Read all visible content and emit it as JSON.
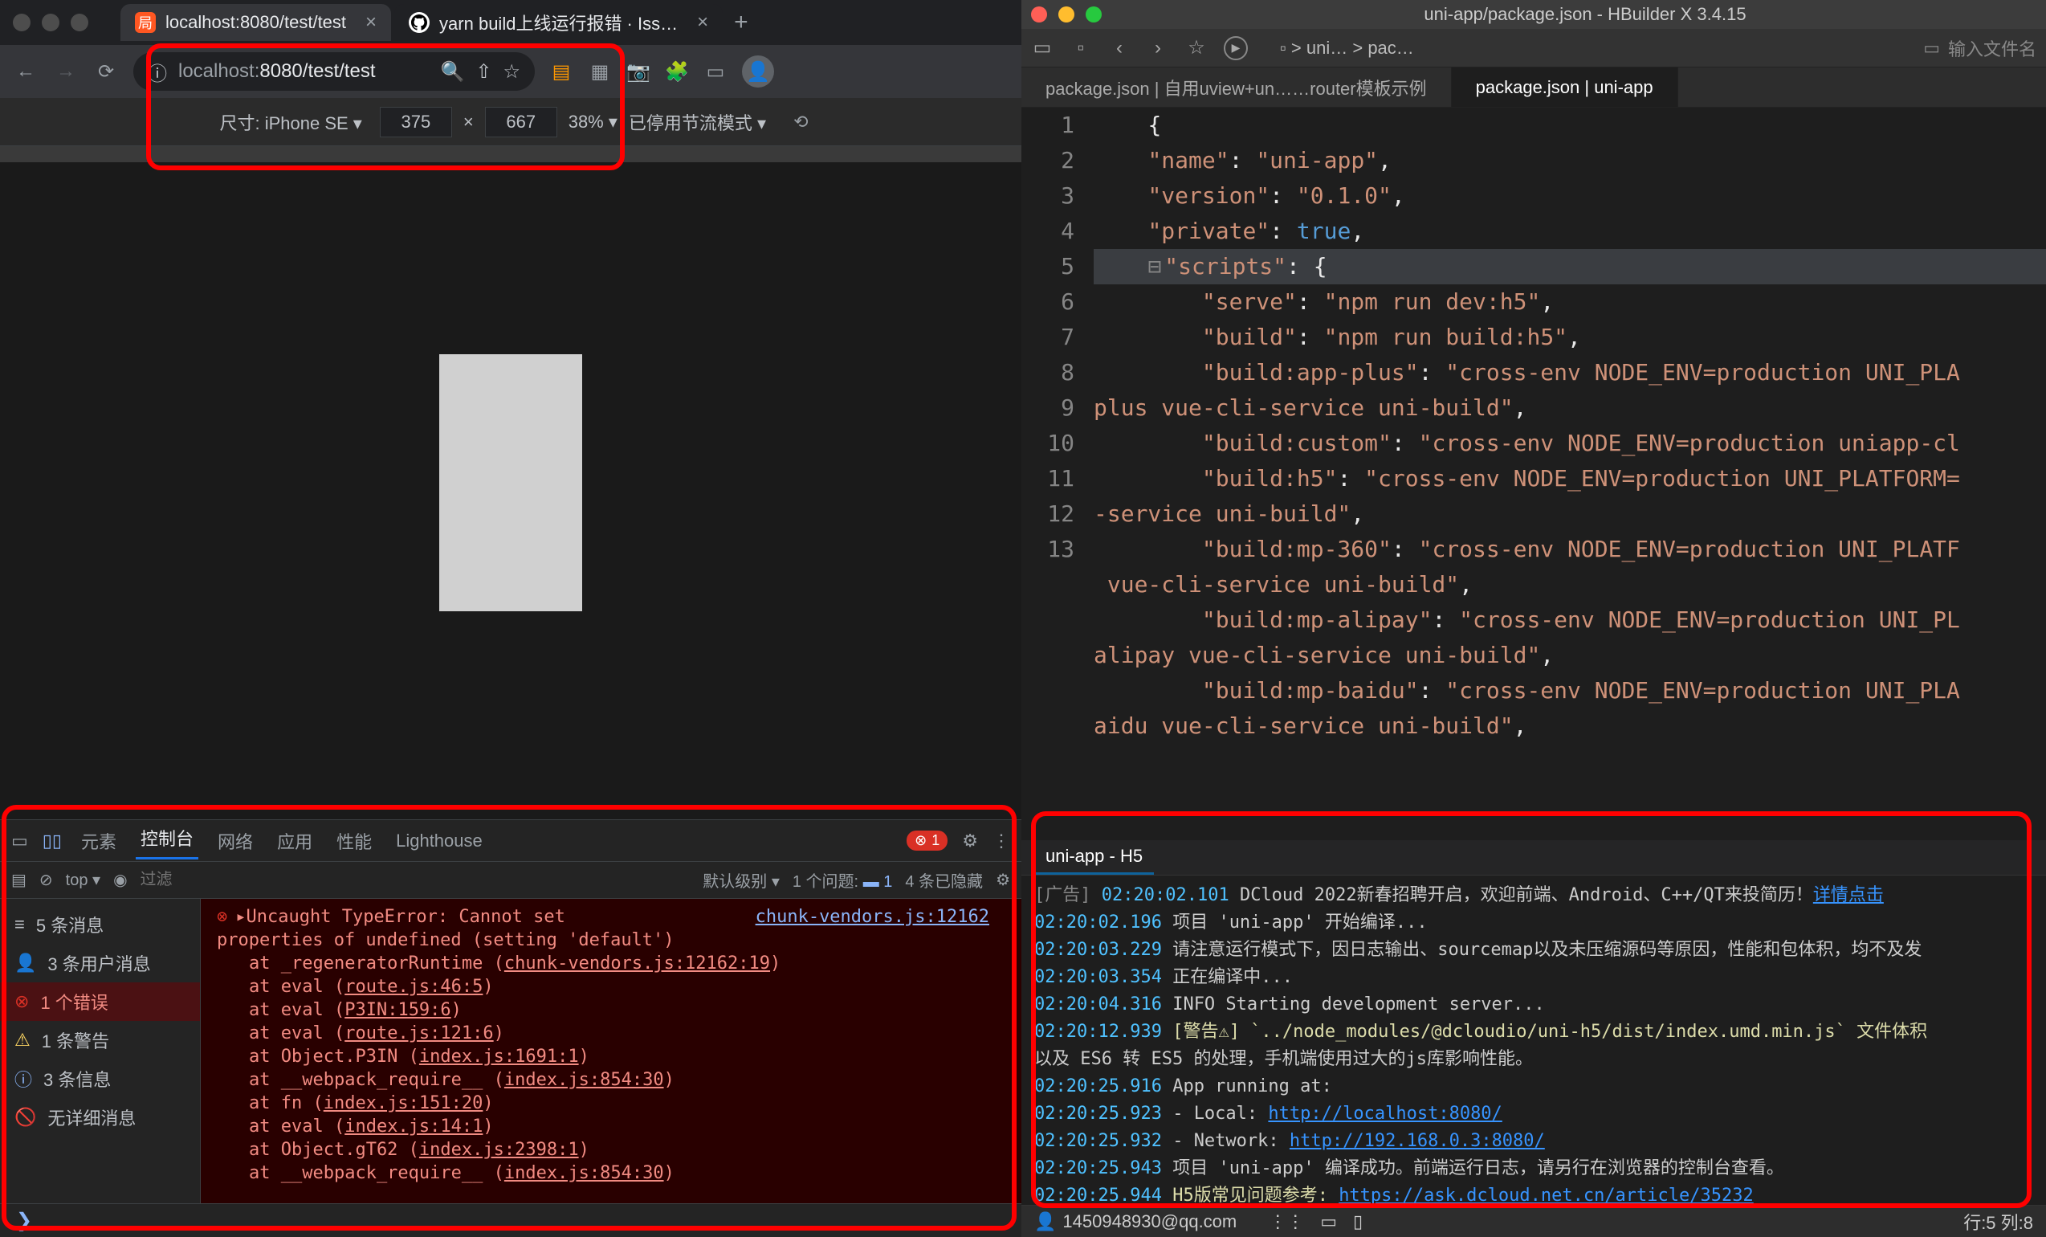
{
  "chrome": {
    "tabs": [
      {
        "label": "localhost:8080/test/test",
        "fav": "橙"
      },
      {
        "label": "yarn build上线运行报错 · Iss…",
        "fav": "gh"
      }
    ],
    "url_gray": "localhost:",
    "url_path": "8080/test/test"
  },
  "device": {
    "label": "尺寸: iPhone SE",
    "width": "375",
    "height": "667",
    "zoom": "38%",
    "throttle": "已停用节流模式"
  },
  "devtools": {
    "tabs": [
      "元素",
      "控制台",
      "网络",
      "应用",
      "性能",
      "Lighthouse"
    ],
    "active_tab": "控制台",
    "error_badge": "1",
    "top": "top",
    "filter_ph": "过滤",
    "level": "默认级别",
    "issues": "1 个问题:",
    "issues_icon": "1",
    "hidden": "4 条已隐藏",
    "sidebar": [
      {
        "icon": "≡",
        "label": "5 条消息"
      },
      {
        "icon": "👤",
        "label": "3 条用户消息"
      },
      {
        "icon": "⊗",
        "label": "1 个错误"
      },
      {
        "icon": "⚠",
        "label": "1 条警告"
      },
      {
        "icon": "ⓘ",
        "label": "3 条信息"
      },
      {
        "icon": "🚫",
        "label": "无详细消息"
      }
    ],
    "error": {
      "head": "Uncaught TypeError: Cannot set",
      "head2": "properties of undefined (setting 'default')",
      "src": "chunk-vendors.js:12162",
      "stack": [
        "at _regeneratorRuntime (chunk-vendors.js:12162:19)",
        "at eval (route.js:46:5)",
        "at eval (P3IN:159:6)",
        "at eval (route.js:121:6)",
        "at Object.P3IN (index.js:1691:1)",
        "at __webpack_require__ (index.js:854:30)",
        "at fn (index.js:151:20)",
        "at eval (index.js:14:1)",
        "at Object.gT62 (index.js:2398:1)",
        "at __webpack_require__ (index.js:854:30)"
      ]
    }
  },
  "hbuilder": {
    "title": "uni-app/package.json - HBuilder X 3.4.15",
    "crumbs": [
      "uni…",
      "pac…"
    ],
    "search_ph": "输入文件名",
    "editor_tabs": [
      "package.json | 自用uview+un……router模板示例",
      "package.json | uni-app"
    ],
    "code": {
      "lines": [
        {
          "n": "1",
          "t": "{"
        },
        {
          "n": "2",
          "k": "\"name\"",
          "s": "\"uni-app\"",
          "e": ","
        },
        {
          "n": "3",
          "k": "\"version\"",
          "s": "\"0.1.0\"",
          "e": ","
        },
        {
          "n": "4",
          "k": "\"private\"",
          "b": "true",
          "e": ","
        },
        {
          "n": "5",
          "k": "\"scripts\"",
          "o": ": {",
          "hl": true
        },
        {
          "n": "6",
          "k": "\"serve\"",
          "s": "\"npm run dev:h5\"",
          "e": ",",
          "ind": 2
        },
        {
          "n": "7",
          "k": "\"build\"",
          "s": "\"npm run build:h5\"",
          "e": ",",
          "ind": 2
        },
        {
          "n": "8",
          "k": "\"build:app-plus\"",
          "s": "\"cross-env NODE_ENV=production UNI_PLA",
          "ind": 2
        },
        {
          "n": "",
          "cont": "plus vue-cli-service uni-build\"",
          "e": ","
        },
        {
          "n": "9",
          "k": "\"build:custom\"",
          "s": "\"cross-env NODE_ENV=production uniapp-cl",
          "ind": 2
        },
        {
          "n": "10",
          "k": "\"build:h5\"",
          "s": "\"cross-env NODE_ENV=production UNI_PLATFORM=",
          "ind": 2
        },
        {
          "n": "",
          "cont": "-service uni-build\"",
          "e": ","
        },
        {
          "n": "11",
          "k": "\"build:mp-360\"",
          "s": "\"cross-env NODE_ENV=production UNI_PLATF",
          "ind": 2
        },
        {
          "n": "",
          "cont": " vue-cli-service uni-build\"",
          "e": ","
        },
        {
          "n": "12",
          "k": "\"build:mp-alipay\"",
          "s": "\"cross-env NODE_ENV=production UNI_PL",
          "ind": 2
        },
        {
          "n": "",
          "cont": "alipay vue-cli-service uni-build\"",
          "e": ","
        },
        {
          "n": "13",
          "k": "\"build:mp-baidu\"",
          "s": "\"cross-env NODE_ENV=production UNI_PLA",
          "ind": 2
        },
        {
          "n": "",
          "cont": "aidu vue-cli-service uni-build\"",
          "e": ","
        }
      ]
    },
    "console_tab": "uni-app - H5",
    "console": [
      {
        "ad": "[广告] ",
        "ts": "02:20:02.101",
        "txt": " DCloud 2022新春招聘开启，欢迎前端、Android、C++/QT来投简历！",
        "url": "详情点击"
      },
      {
        "ts": "02:20:02.196",
        "txt": " 项目 'uni-app' 开始编译..."
      },
      {
        "ts": "02:20:03.229",
        "txt": " 请注意运行模式下，因日志输出、sourcemap以及未压缩源码等原因，性能和包体积，均不及发"
      },
      {
        "ts": "02:20:03.354",
        "txt": " 正在编译中..."
      },
      {
        "ts": "02:20:04.316",
        "txt": " INFO  Starting development server..."
      },
      {
        "ts": "02:20:12.939",
        "warn": " [警告⚠] `../node_modules/@dcloudio/uni-h5/dist/index.umd.min.js` 文件体积"
      },
      {
        "cont": "以及 ES6 转 ES5 的处理，手机端使用过大的js库影响性能。"
      },
      {
        "ts": "02:20:25.916",
        "txt": "   App running at:"
      },
      {
        "ts": "02:20:25.923",
        "txt": "   - Local:   ",
        "url": "http://localhost:8080/"
      },
      {
        "ts": "02:20:25.932",
        "txt": "   - Network: ",
        "url": "http://192.168.0.3:8080/"
      },
      {
        "ts": "02:20:25.943",
        "txt": " 项目 'uni-app' 编译成功。前端运行日志，请另行在浏览器的控制台查看。"
      },
      {
        "ts": "02:20:25.944",
        "hl": " H5版常见问题参考: ",
        "url": "https://ask.dcloud.net.cn/article/35232"
      }
    ],
    "status": {
      "email": "1450948930@qq.com",
      "pos": "行:5  列:8"
    }
  }
}
